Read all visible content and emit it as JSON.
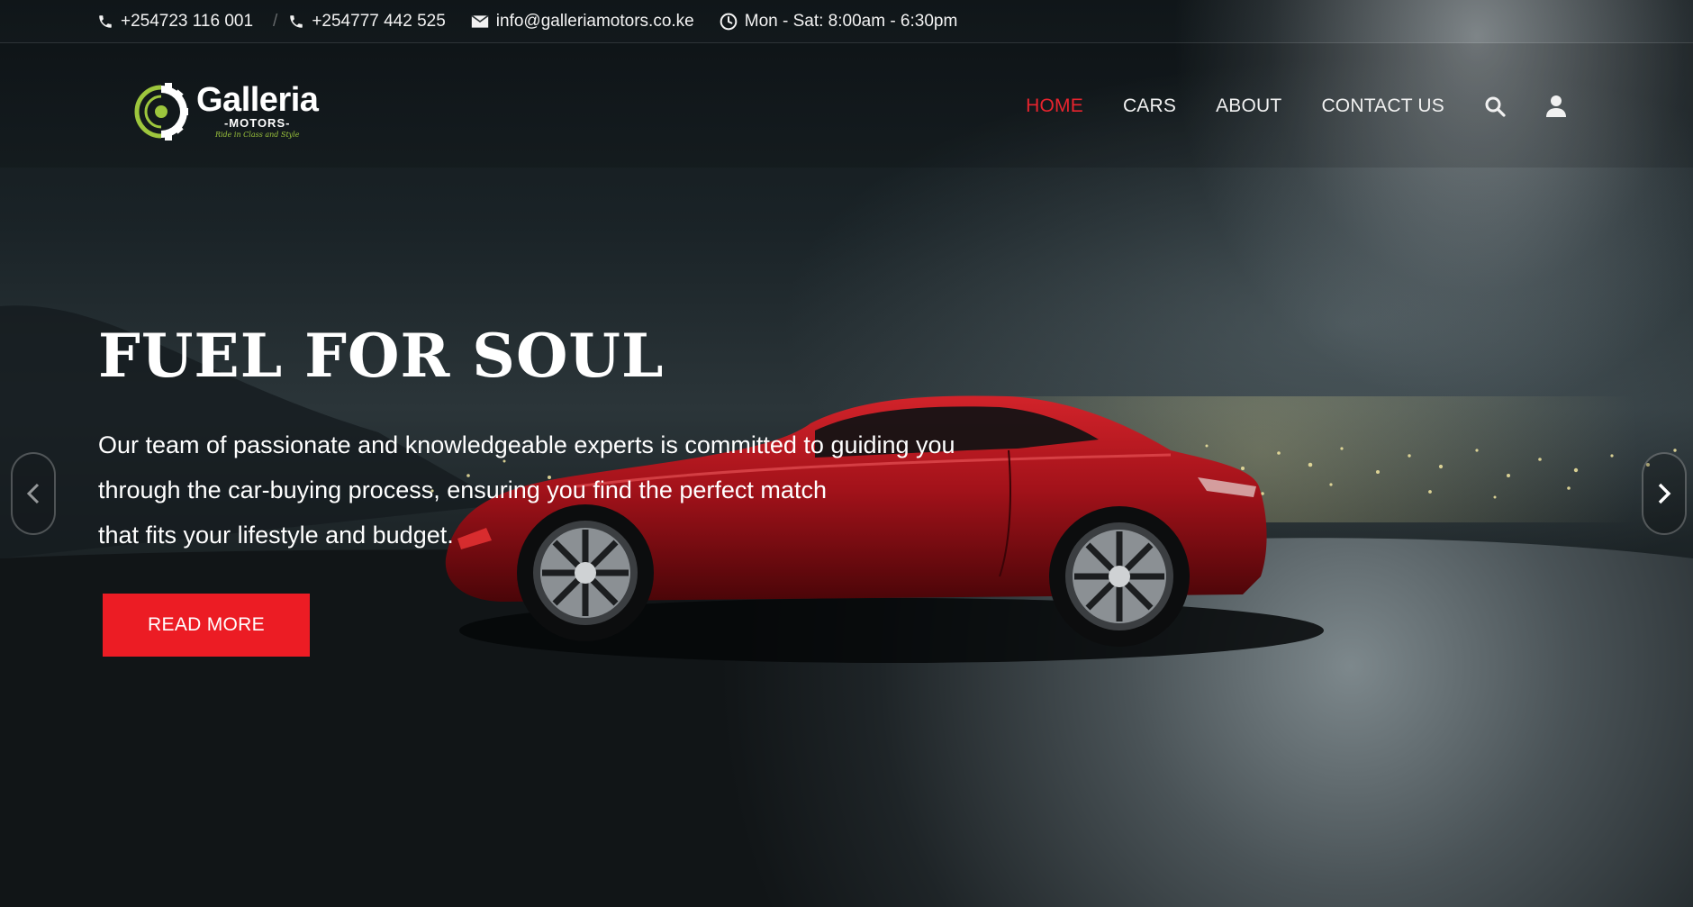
{
  "contact_bar": {
    "phone_1": "+254723 116 001",
    "separator": "/",
    "phone_2": "+254777 442 525",
    "email": "info@galleriamotors.co.ke",
    "hours": "Mon - Sat: 8:00am - 6:30pm"
  },
  "logo": {
    "brand": "Galleria",
    "sub": "-MOTORS-",
    "tagline": "Ride in Class and Style"
  },
  "nav": {
    "items": [
      {
        "label": "HOME",
        "active": true
      },
      {
        "label": "CARS",
        "active": false
      },
      {
        "label": "ABOUT",
        "active": false
      },
      {
        "label": "CONTACT US",
        "active": false
      }
    ],
    "search_icon": "search-icon",
    "account_icon": "user-icon"
  },
  "hero": {
    "headline": "FUEL FOR SOUL",
    "lead_lines": [
      "Our team of passionate and knowledgeable experts is committed to guiding you",
      "through the car-buying process, ensuring you find the perfect match",
      "that fits your lifestyle and budget."
    ],
    "cta_label": "READ MORE",
    "prev_icon": "chevron-left-icon",
    "next_icon": "chevron-right-icon"
  },
  "colors": {
    "accent_red": "#ec1c24",
    "nav_active": "#e8242e",
    "logo_green": "#9dc63d"
  }
}
